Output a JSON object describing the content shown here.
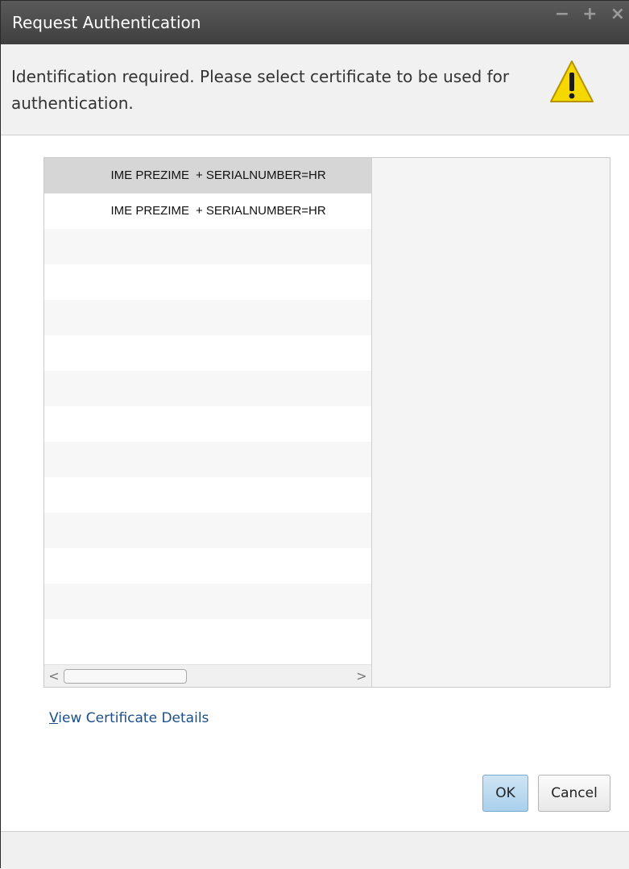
{
  "window": {
    "title": "Request Authentication",
    "controls": {
      "minimize": "−",
      "maximize": "+",
      "close": "×"
    }
  },
  "header": {
    "message": "Identification required. Please select certificate to be used for authentication.",
    "icon": "warning-icon"
  },
  "certificates": [
    {
      "name": "IME PREZIME",
      "detail": "+ SERIALNUMBER=HR"
    },
    {
      "name": "IME PREZIME",
      "detail": "+ SERIALNUMBER=HR"
    }
  ],
  "scrollbar": {
    "left_arrow": "<",
    "right_arrow": ">"
  },
  "links": {
    "view_details_first": "V",
    "view_details_rest": "iew Certificate Details"
  },
  "buttons": {
    "ok": "OK",
    "cancel": "Cancel"
  },
  "colors": {
    "ok_button": "#a9d0ec",
    "titlebar": "#4a4a4a",
    "warning": "#f5d800"
  }
}
